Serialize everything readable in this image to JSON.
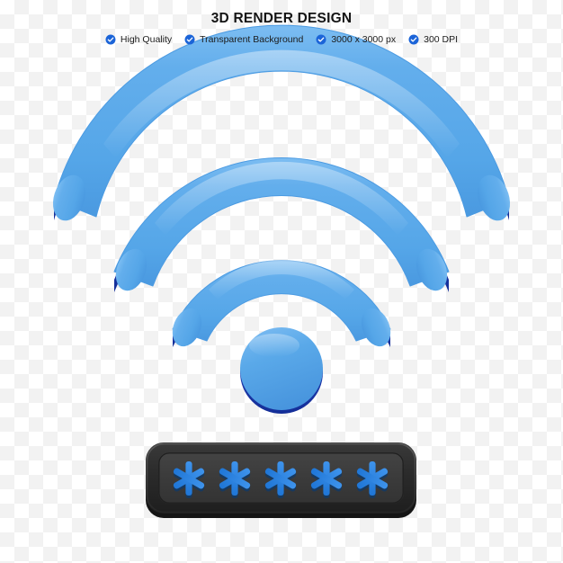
{
  "header": {
    "title": "3D RENDER DESIGN",
    "badges": [
      {
        "icon": "check-circle-icon",
        "label": "High Quality"
      },
      {
        "icon": "check-circle-icon",
        "label": "Transparent Background"
      },
      {
        "icon": "check-circle-icon",
        "label": "3000 x 3000 px"
      },
      {
        "icon": "check-circle-icon",
        "label": "300 DPI"
      }
    ]
  },
  "artwork": {
    "name": "wifi-3d-icon",
    "description": "3D rendered wifi signal with password field",
    "arcs": [
      {
        "name": "wifi-arc-outer"
      },
      {
        "name": "wifi-arc-middle"
      },
      {
        "name": "wifi-arc-inner"
      }
    ],
    "dot": {
      "name": "wifi-dot"
    },
    "password_field": {
      "name": "password-bar",
      "mask_character": "*",
      "mask_count": 5,
      "masked_value": "*****"
    }
  },
  "colors": {
    "accent_blue": "#52A5E8",
    "blue_light": "#74B9F0",
    "blue_deep": "#1C36A8",
    "badge_blue": "#1B64D8",
    "bar_outer": "#2B2B2B",
    "bar_inner": "#3C3C3C",
    "asterisk_blue": "#2B84E0",
    "text_dark": "#141414",
    "checker_light": "#ffffff",
    "checker_dark": "#f2f2f2"
  }
}
